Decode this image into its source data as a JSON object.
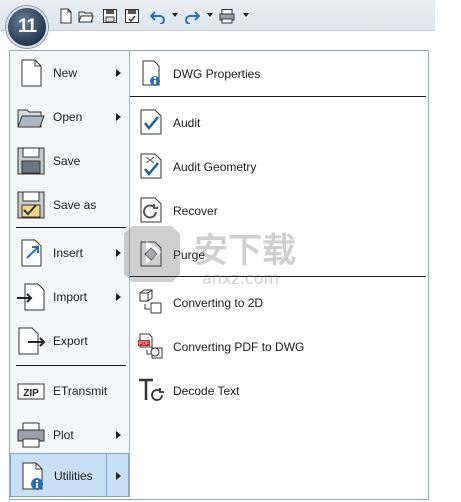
{
  "app": {
    "logo_text": "11"
  },
  "quick_access": {
    "icons": [
      "new-icon",
      "open-icon",
      "save-icon",
      "save-as-icon",
      "undo-icon",
      "redo-icon",
      "plot-icon",
      "customize-icon"
    ]
  },
  "left_menu": {
    "items": [
      {
        "label": "New",
        "submenu": true
      },
      {
        "label": "Open",
        "submenu": true
      },
      {
        "label": "Save",
        "submenu": false
      },
      {
        "label": "Save as",
        "submenu": false
      },
      {
        "label": "Insert",
        "submenu": true
      },
      {
        "label": "Import",
        "submenu": true
      },
      {
        "label": "Export",
        "submenu": false
      },
      {
        "label": "ETransmit",
        "submenu": false
      },
      {
        "label": "Plot",
        "submenu": true
      },
      {
        "label": "Utilities",
        "submenu": true,
        "active": true
      }
    ]
  },
  "utilities_menu": {
    "items": [
      {
        "label": "DWG Properties"
      },
      {
        "label": "Audit"
      },
      {
        "label": "Audit Geometry"
      },
      {
        "label": "Recover"
      },
      {
        "label": "Purge"
      },
      {
        "label": "Converting to 2D"
      },
      {
        "label": "Converting PDF to DWG"
      },
      {
        "label": "Decode Text"
      }
    ]
  },
  "icons": {
    "etransmit_text": "ZIP",
    "pdf_text": "PDF"
  },
  "watermark": {
    "text": "安下载",
    "subtext": "anxz.com"
  },
  "colors": {
    "active_bg": "#c9dff3",
    "active_border": "#7ba7cf",
    "accent_blue": "#2a6fb5"
  }
}
